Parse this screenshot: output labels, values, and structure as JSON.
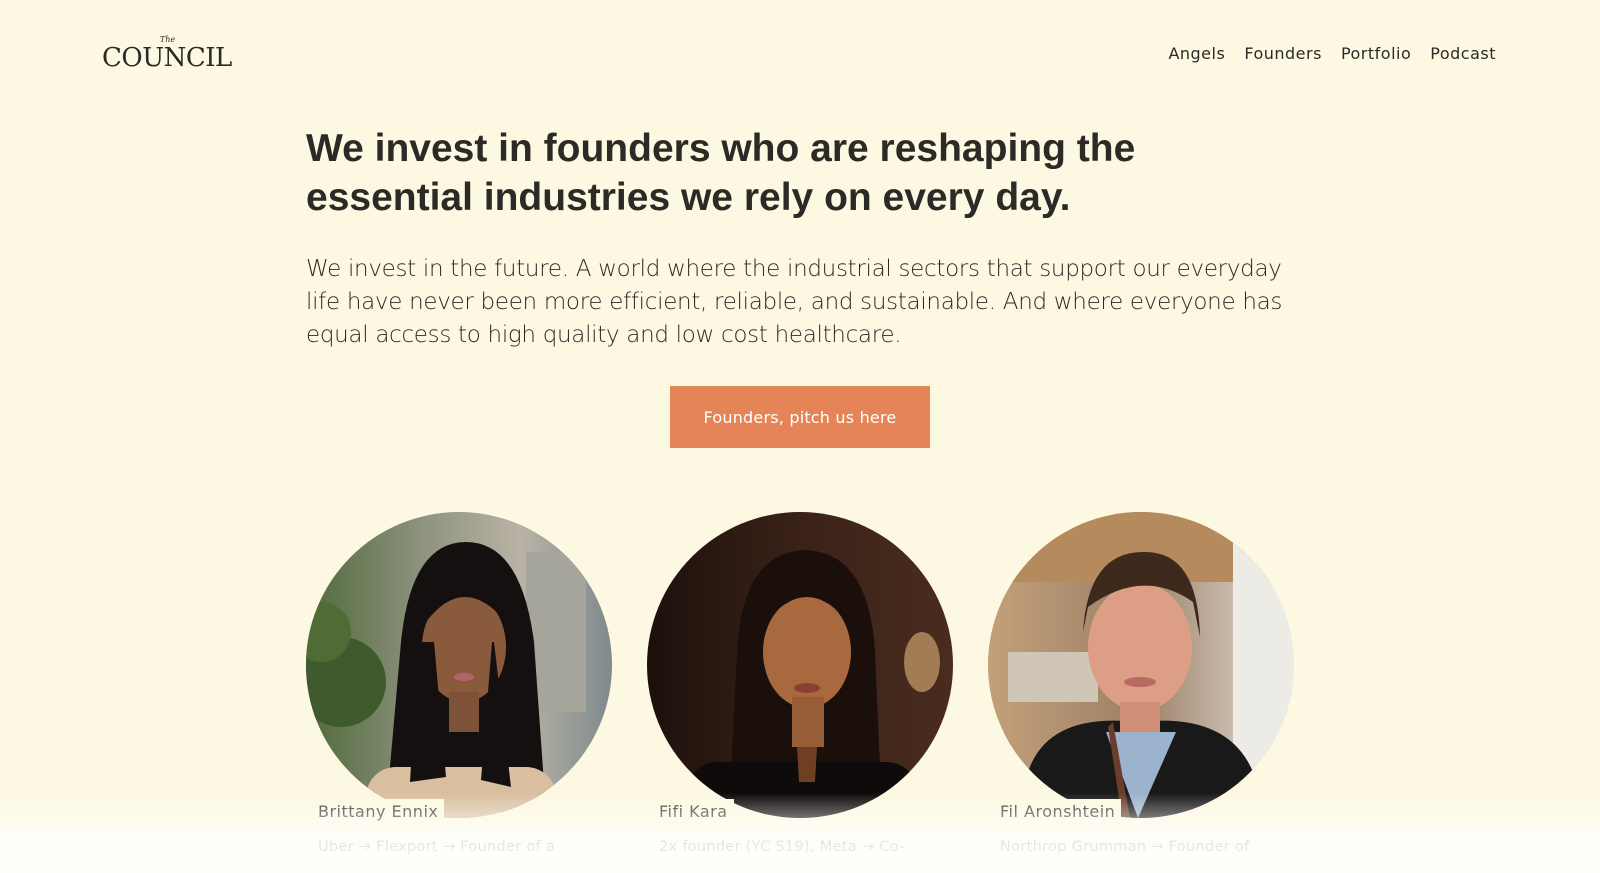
{
  "header": {
    "logo_small": "The",
    "logo_main": "COUNCIL",
    "nav": [
      "Angels",
      "Founders",
      "Portfolio",
      "Podcast"
    ]
  },
  "hero": {
    "headline": "We invest in founders who are reshaping the essential industries we rely on every day.",
    "subhead": "We invest in the future. A world where the industrial sectors that support our everyday life have never been more efficient, reliable, and sustainable. And where everyone has equal access to high quality and low cost healthcare.",
    "cta_label": "Founders, pitch us here"
  },
  "team": [
    {
      "name": "Brittany Ennix",
      "desc": "Uber → Flexport → Founder of a"
    },
    {
      "name": "Fifi Kara",
      "desc": "2x founder (YC S19), Meta → Co-"
    },
    {
      "name": "Fil Aronshtein",
      "desc": "Northrop Grumman → Founder of"
    }
  ],
  "colors": {
    "background": "#fdf8e1",
    "accent": "#e58456",
    "text": "#2b2a27"
  }
}
